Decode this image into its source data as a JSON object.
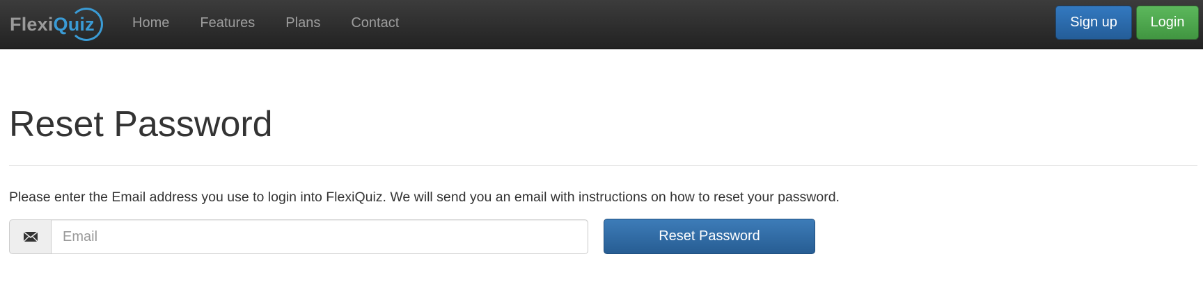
{
  "brand": {
    "part1": "Flexi",
    "part2": "Quiz"
  },
  "nav": {
    "links": [
      "Home",
      "Features",
      "Plans",
      "Contact"
    ],
    "signup_label": "Sign up",
    "login_label": "Login"
  },
  "main": {
    "title": "Reset Password",
    "instructions": "Please enter the Email address you use to login into FlexiQuiz. We will send you an email with instructions on how to reset your password.",
    "email_placeholder": "Email",
    "email_value": "",
    "reset_button_label": "Reset Password"
  },
  "icons": {
    "email_addon": "envelope-icon"
  },
  "colors": {
    "navbar": "#2b2b2b",
    "brand_accent": "#3a9bd5",
    "signup_button": "#2d6db0",
    "login_button": "#4cae4c",
    "reset_button": "#2e6aa6"
  }
}
